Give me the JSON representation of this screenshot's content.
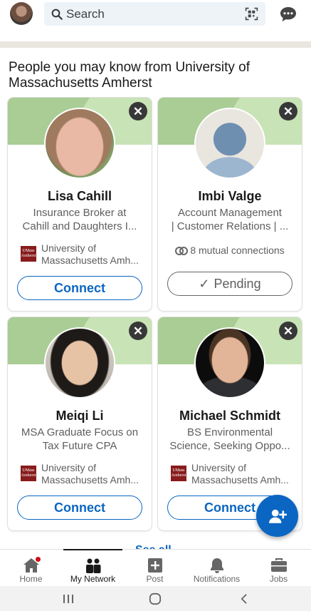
{
  "search": {
    "placeholder": "Search"
  },
  "section": {
    "title": "People you may know from University of Massachusetts Amherst"
  },
  "cards": [
    {
      "name": "Lisa Cahill",
      "headline_line1": "Insurance Broker at",
      "headline_line2": "Cahill and Daughters I...",
      "school_line1": "University of",
      "school_line2": "Massachusetts Amh...",
      "button": "Connect"
    },
    {
      "name": "Imbi Valge",
      "headline_line1": "Account Management",
      "headline_line2": "| Customer Relations | ...",
      "mutual": "8 mutual connections",
      "button": "Pending"
    },
    {
      "name": "Meiqi Li",
      "headline_line1": "MSA Graduate Focus on",
      "headline_line2": "Tax Future CPA",
      "school_line1": "University of",
      "school_line2": "Massachusetts Amh...",
      "button": "Connect"
    },
    {
      "name": "Michael Schmidt",
      "headline_line1": "BS Environmental",
      "headline_line2": "Science, Seeking Oppo...",
      "school_line1": "University of",
      "school_line2": "Massachusetts Amh...",
      "button": "Connect"
    }
  ],
  "school_logo_text": "UMass Amherst",
  "see_all": "See all",
  "nav": {
    "home": "Home",
    "my_network": "My Network",
    "post": "Post",
    "notifications": "Notifications",
    "jobs": "Jobs"
  },
  "colors": {
    "accent": "#0a66c2",
    "banner": "#a9cd95",
    "umass": "#881c1c",
    "notification_dot": "#cc1016"
  }
}
